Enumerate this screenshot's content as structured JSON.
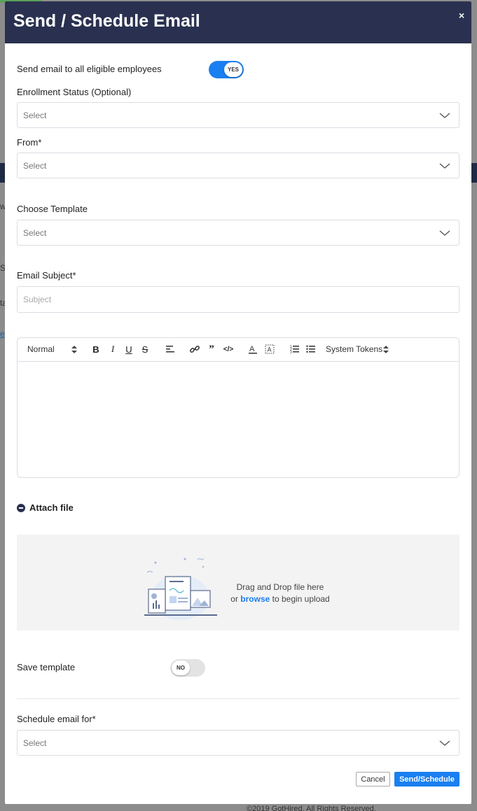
{
  "background": {
    "footer_text": "©2019 GotHired. All Rights Reserved.",
    "fragments": [
      "w",
      "S",
      "ta",
      "e"
    ]
  },
  "modal": {
    "title": "Send / Schedule Email",
    "close_label": "×"
  },
  "send_all": {
    "label": "Send email to all eligible employees",
    "toggle_text": "YES",
    "toggle_on": true
  },
  "enrollment_status": {
    "label": "Enrollment Status (Optional)",
    "value": "Select"
  },
  "from": {
    "label": "From*",
    "value": "Select"
  },
  "template": {
    "label": "Choose Template",
    "value": "Select"
  },
  "subject": {
    "label": "Email Subject*",
    "placeholder": "Subject"
  },
  "editor": {
    "format_select": "Normal",
    "system_tokens": "System Tokens",
    "toolbar_buttons": [
      "bold",
      "italic",
      "underline",
      "strike",
      "align",
      "link",
      "blockquote",
      "code",
      "text-color",
      "background",
      "ordered-list",
      "bullet-list"
    ]
  },
  "attach": {
    "label": "Attach file",
    "drop_line1": "Drag and Drop file here",
    "drop_or": "or",
    "browse": "browse",
    "drop_line2_end": "to begin upload"
  },
  "save_template": {
    "label": "Save template",
    "toggle_text": "NO",
    "toggle_on": false
  },
  "schedule": {
    "label": "Schedule email for*",
    "value": "Select"
  },
  "actions": {
    "cancel": "Cancel",
    "send": "Send/Schedule"
  },
  "colors": {
    "header": "#2a3150",
    "accent": "#1a7ff0"
  }
}
